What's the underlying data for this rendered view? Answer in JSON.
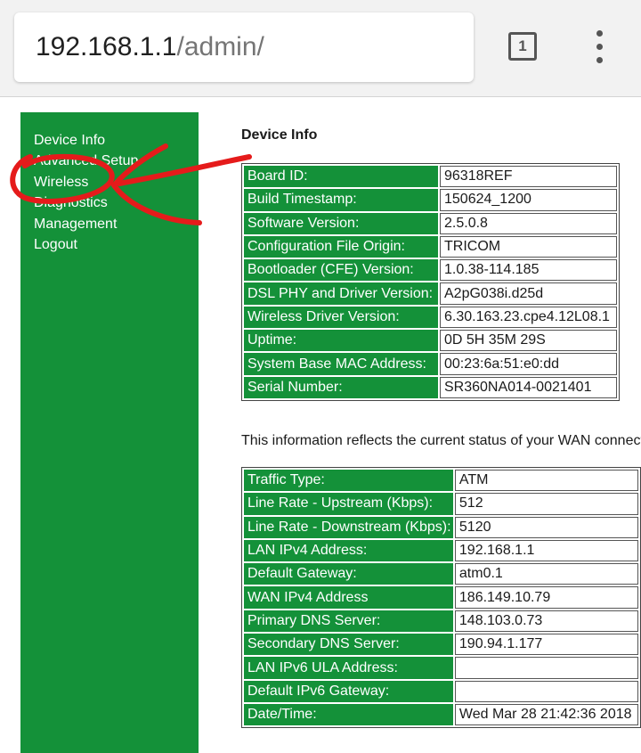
{
  "browser": {
    "url_host": "192.168.1.1",
    "url_path": "/admin/",
    "tab_count": "1",
    "menu_icon": "more-vert-icon"
  },
  "sidebar": {
    "items": [
      {
        "label": "Device Info"
      },
      {
        "label": "Advanced Setup"
      },
      {
        "label": "Wireless"
      },
      {
        "label": "Diagnostics"
      },
      {
        "label": "Management"
      },
      {
        "label": "Logout"
      }
    ]
  },
  "main": {
    "title": "Device Info",
    "device_rows": [
      {
        "label": "Board ID:",
        "value": "96318REF"
      },
      {
        "label": "Build Timestamp:",
        "value": "150624_1200"
      },
      {
        "label": "Software Version:",
        "value": "2.5.0.8"
      },
      {
        "label": "Configuration File Origin:",
        "value": "TRICOM"
      },
      {
        "label": "Bootloader (CFE) Version:",
        "value": "1.0.38-114.185"
      },
      {
        "label": "DSL PHY and Driver Version:",
        "value": "A2pG038i.d25d"
      },
      {
        "label": "Wireless Driver Version:",
        "value": "6.30.163.23.cpe4.12L08.1"
      },
      {
        "label": "Uptime:",
        "value": "0D 5H 35M 29S"
      },
      {
        "label": "System Base MAC Address:",
        "value": "00:23:6a:51:e0:dd"
      },
      {
        "label": "Serial Number:",
        "value": "SR360NA014-0021401"
      }
    ],
    "status_note": "This information reflects the current status of your WAN connection.",
    "wan_rows": [
      {
        "label": "Traffic Type:",
        "value": "ATM"
      },
      {
        "label": "Line Rate - Upstream (Kbps):",
        "value": "512"
      },
      {
        "label": "Line Rate - Downstream (Kbps):",
        "value": "5120"
      },
      {
        "label": "LAN IPv4 Address:",
        "value": "192.168.1.1"
      },
      {
        "label": "Default Gateway:",
        "value": "atm0.1"
      },
      {
        "label": "WAN IPv4 Address",
        "value": "186.149.10.79"
      },
      {
        "label": "Primary DNS Server:",
        "value": "148.103.0.73"
      },
      {
        "label": "Secondary DNS Server:",
        "value": "190.94.1.177"
      },
      {
        "label": "LAN IPv6 ULA Address:",
        "value": ""
      },
      {
        "label": "Default IPv6 Gateway:",
        "value": ""
      },
      {
        "label": "Date/Time:",
        "value": "Wed Mar 28 21:42:36 2018"
      }
    ]
  },
  "colors": {
    "sidebar_green": "#149139",
    "annotation_red": "#e51b1b"
  }
}
